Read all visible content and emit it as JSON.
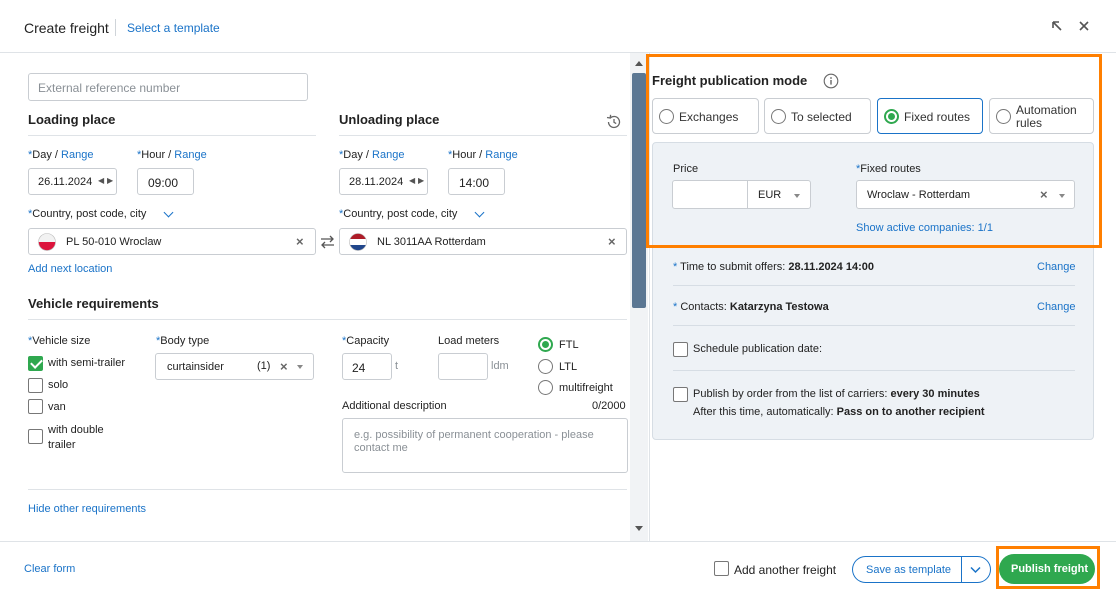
{
  "header": {
    "title": "Create freight",
    "template_link": "Select a template"
  },
  "form": {
    "ext_ref_placeholder": "External reference number",
    "loading": {
      "title": "Loading place",
      "day_label": "Day",
      "range": "Range",
      "hour_label": "Hour",
      "date": "26.11.2024",
      "hour": "09:00",
      "country_label": "Country, post code, city",
      "location": "PL 50-010 Wroclaw",
      "add_next": "Add next location"
    },
    "unloading": {
      "title": "Unloading place",
      "day_label": "Day",
      "range": "Range",
      "hour_label": "Hour",
      "date": "28.11.2024",
      "hour": "14:00",
      "country_label": "Country, post code, city",
      "location": "NL 3011AA Rotterdam"
    },
    "vehicle": {
      "title": "Vehicle requirements",
      "size_label": "Vehicle size",
      "sizes": [
        {
          "label": "with semi-trailer",
          "checked": true
        },
        {
          "label": "solo",
          "checked": false
        },
        {
          "label": "van",
          "checked": false
        },
        {
          "label": "with double trailer",
          "checked": false
        }
      ],
      "body_type_label": "Body type",
      "body_type_value": "curtainsider",
      "body_type_count": "(1)",
      "capacity_label": "Capacity",
      "capacity_value": "24",
      "capacity_unit": "t",
      "load_meters_label": "Load meters",
      "load_meters_unit": "ldm",
      "load_types": [
        {
          "label": "FTL",
          "selected": true
        },
        {
          "label": "LTL",
          "selected": false
        },
        {
          "label": "multifreight",
          "selected": false
        }
      ],
      "additional_label": "Additional description",
      "additional_count": "0/2000",
      "additional_placeholder": "e.g. possibility of permanent cooperation - please contact me"
    },
    "hide_requirements": "Hide other requirements"
  },
  "publication": {
    "title": "Freight publication mode",
    "modes": [
      {
        "label": "Exchanges",
        "selected": false
      },
      {
        "label": "To selected",
        "selected": false
      },
      {
        "label": "Fixed routes",
        "selected": true
      },
      {
        "label": "Automation rules",
        "selected": false
      }
    ],
    "price_label": "Price",
    "currency": "EUR",
    "fixed_routes_label": "Fixed routes",
    "fixed_routes_value": "Wroclaw - Rotterdam",
    "show_active": "Show active companies: 1/1",
    "time_label": "Time to submit offers: ",
    "time_value": "28.11.2024 14:00",
    "contacts_label": "Contacts: ",
    "contacts_value": "Katarzyna Testowa",
    "change": "Change",
    "schedule_label": "Schedule publication date:",
    "publish_order_label": "Publish by order from the list of carriers: ",
    "publish_order_value": "every 30 minutes",
    "after_label": "After this time, automatically: ",
    "after_value": "Pass on to another recipient"
  },
  "footer": {
    "clear_form": "Clear form",
    "add_another": "Add another freight",
    "save_template": "Save as template",
    "publish": "Publish freight"
  },
  "colors": {
    "accent": "#1a73c8",
    "green": "#2fa84f",
    "highlight": "#ff7f00"
  }
}
